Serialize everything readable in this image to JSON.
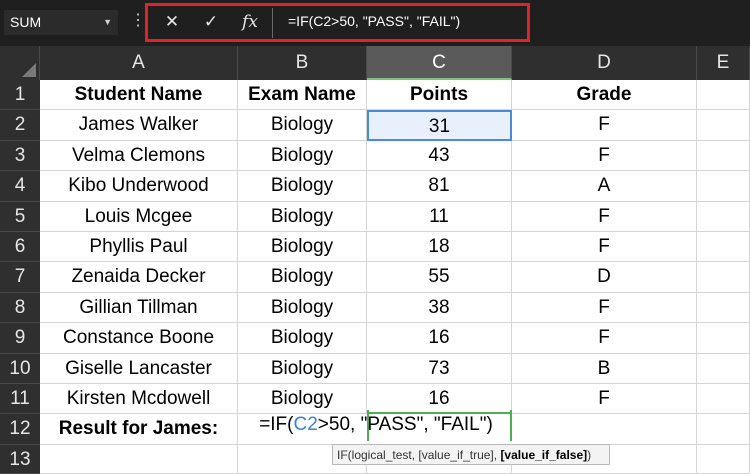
{
  "formula_bar": {
    "name_box": "SUM",
    "cancel_icon": "✕",
    "enter_icon": "✓",
    "fx_icon": "fx",
    "formula": "=IF(C2>50, \"PASS\", \"FAIL\")"
  },
  "columns": [
    "A",
    "B",
    "C",
    "D",
    "E"
  ],
  "rows": [
    "1",
    "2",
    "3",
    "4",
    "5",
    "6",
    "7",
    "8",
    "9",
    "10",
    "11",
    "12",
    "13"
  ],
  "headers": {
    "student": "Student Name",
    "exam": "Exam Name",
    "points": "Points",
    "grade": "Grade"
  },
  "table": [
    {
      "name": "James Walker",
      "exam": "Biology",
      "points": "31",
      "grade": "F"
    },
    {
      "name": "Velma Clemons",
      "exam": "Biology",
      "points": "43",
      "grade": "F"
    },
    {
      "name": "Kibo Underwood",
      "exam": "Biology",
      "points": "81",
      "grade": "A"
    },
    {
      "name": "Louis Mcgee",
      "exam": "Biology",
      "points": "11",
      "grade": "F"
    },
    {
      "name": "Phyllis Paul",
      "exam": "Biology",
      "points": "18",
      "grade": "F"
    },
    {
      "name": "Zenaida Decker",
      "exam": "Biology",
      "points": "55",
      "grade": "D"
    },
    {
      "name": "Gillian Tillman",
      "exam": "Biology",
      "points": "38",
      "grade": "F"
    },
    {
      "name": "Constance Boone",
      "exam": "Biology",
      "points": "16",
      "grade": "F"
    },
    {
      "name": "Giselle Lancaster",
      "exam": "Biology",
      "points": "73",
      "grade": "B"
    },
    {
      "name": "Kirsten Mcdowell",
      "exam": "Biology",
      "points": "16",
      "grade": "F"
    }
  ],
  "result_label": "Result for James:",
  "editing": {
    "prefix": "=IF(",
    "ref": "C2",
    "suffix": ">50, \"PASS\", \"FAIL\")"
  },
  "tooltip": {
    "func": "IF(",
    "args": "logical_test, [value_if_true], ",
    "active": "[value_if_false]",
    "close": ")"
  },
  "colors": {
    "selection": "#4a8ad8",
    "highlight_box": "#e0222a",
    "ref_color": "#3b7fd1"
  }
}
